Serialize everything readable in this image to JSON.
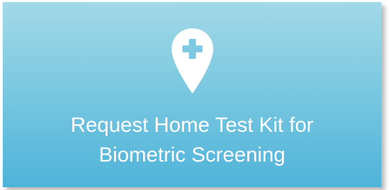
{
  "card": {
    "title_line1": "Request Home Test Kit for",
    "title_line2": "Biometric Screening",
    "icon": "location-pin-plus-icon",
    "colors": {
      "gradient_top": "#a3d9e8",
      "gradient_bottom": "#4fb3d9",
      "icon_fill": "#ffffff",
      "icon_symbol": "#7cc9e1"
    }
  }
}
